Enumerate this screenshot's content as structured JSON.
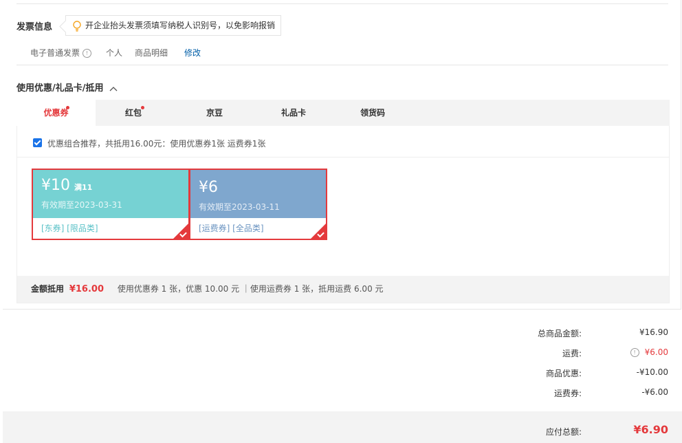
{
  "invoice": {
    "title": "发票信息",
    "tip": "开企业抬头发票须填写纳税人识别号，以免影响报销",
    "type": "电子普通发票",
    "info_icon": "info-icon",
    "title_type": "个人",
    "content": "商品明细",
    "edit": "修改"
  },
  "discount": {
    "title": "使用优惠/礼品卡/抵用",
    "tabs": [
      {
        "label": "优惠券",
        "active": true,
        "dot": true
      },
      {
        "label": "红包",
        "active": false,
        "dot": true
      },
      {
        "label": "京豆",
        "active": false,
        "dot": false
      },
      {
        "label": "礼品卡",
        "active": false,
        "dot": false
      },
      {
        "label": "领货码",
        "active": false,
        "dot": false
      }
    ],
    "combo_text": "优惠组合推荐，共抵用16.00元：使用优惠券1张 运费券1张",
    "coupons": [
      {
        "amount": "¥10",
        "condition": "满11",
        "valid": "有效期至2023-03-31",
        "tags": "[东券] [限品类]",
        "color": "#76d2d3",
        "tag_color": "#5ac1c7"
      },
      {
        "amount": "¥6",
        "condition": "",
        "valid": "有效期至2023-03-11",
        "tags": "[运费券] [全品类]",
        "color": "#7fa7ce",
        "tag_color": "#6b94c1"
      }
    ],
    "summary_label": "金额抵用",
    "summary_amount": "¥16.00",
    "summary_detail": "使用优惠券 1 张，优惠 10.00 元 ｜使用运费券 1 张，抵用运费 6.00 元"
  },
  "totals": {
    "goods_label": "总商品金额:",
    "goods_value": "¥16.90",
    "shipping_label": "运费:",
    "shipping_value": "¥6.00",
    "discount_label": "商品优惠:",
    "discount_value": "-¥10.00",
    "shipcoupon_label": "运费券:",
    "shipcoupon_value": "-¥6.00",
    "pay_label": "应付总额:",
    "pay_value": "¥6.90"
  },
  "colors": {
    "accent": "#e4393c",
    "orange": "#e4393c",
    "link": "#005ea7"
  }
}
